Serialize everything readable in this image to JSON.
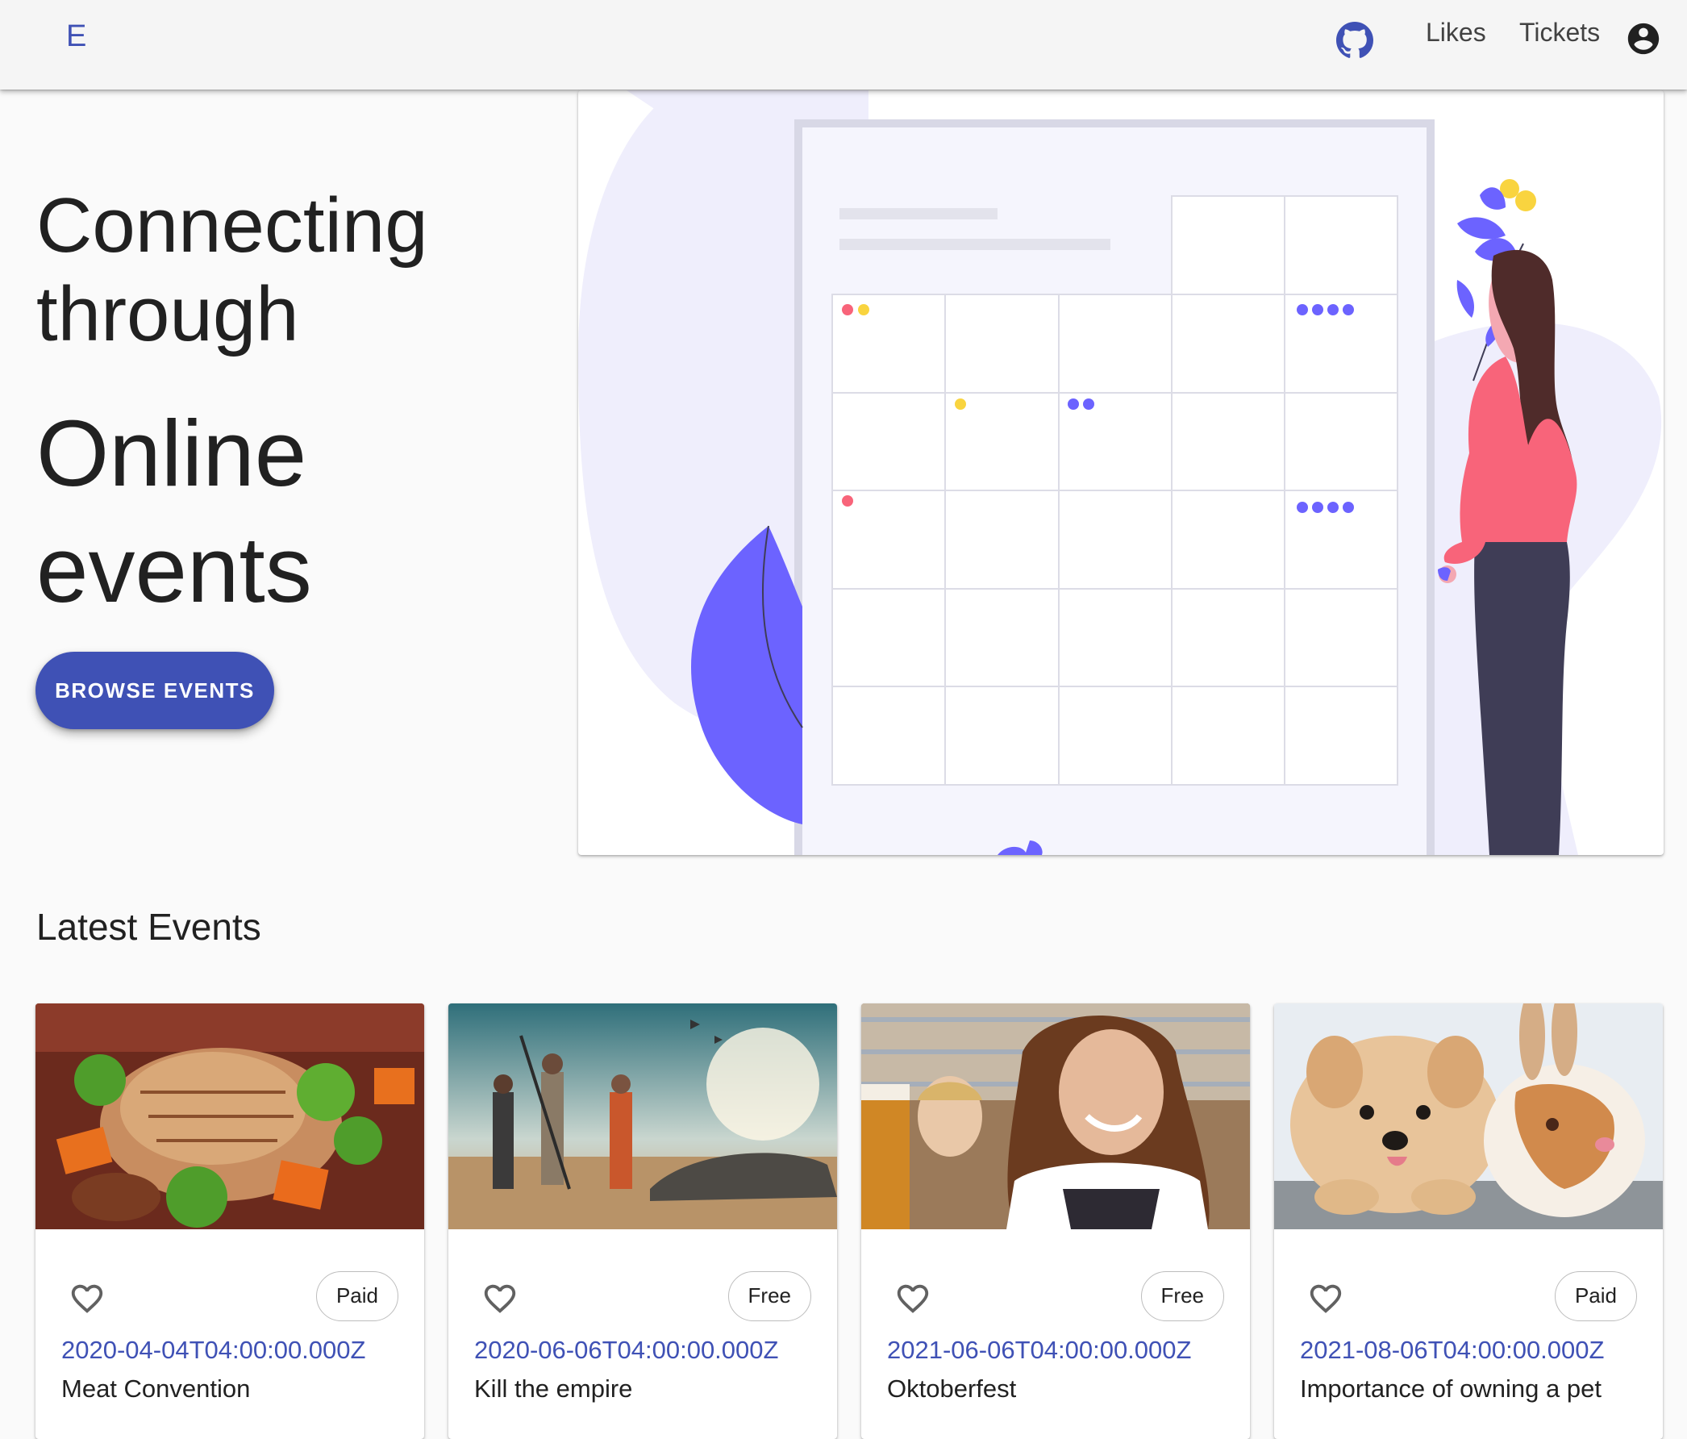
{
  "appbar": {
    "logo": "E",
    "github_icon": "github-icon",
    "likes_label": "Likes",
    "tickets_label": "Tickets",
    "account_icon": "account-circle-icon"
  },
  "hero": {
    "title": "Connecting through",
    "subtitle": "Online events",
    "browse_label": "BROWSE EVENTS"
  },
  "colors": {
    "primary": "#3f51b5",
    "illustration_purple": "#6c63ff",
    "illustration_pink": "#f8647a",
    "illustration_yellow": "#f9d43f"
  },
  "latest": {
    "title": "Latest Events",
    "events": [
      {
        "date": "2020-04-04T04:00:00.000Z",
        "title": "Meat Convention",
        "price": "Paid",
        "like_icon": "heart-outline-icon"
      },
      {
        "date": "2020-06-06T04:00:00.000Z",
        "title": "Kill the empire",
        "price": "Free",
        "like_icon": "heart-outline-icon"
      },
      {
        "date": "2021-06-06T04:00:00.000Z",
        "title": "Oktoberfest",
        "price": "Free",
        "like_icon": "heart-outline-icon"
      },
      {
        "date": "2021-08-06T04:00:00.000Z",
        "title": "Importance of owning a pet",
        "price": "Paid",
        "like_icon": "heart-outline-icon"
      }
    ]
  }
}
